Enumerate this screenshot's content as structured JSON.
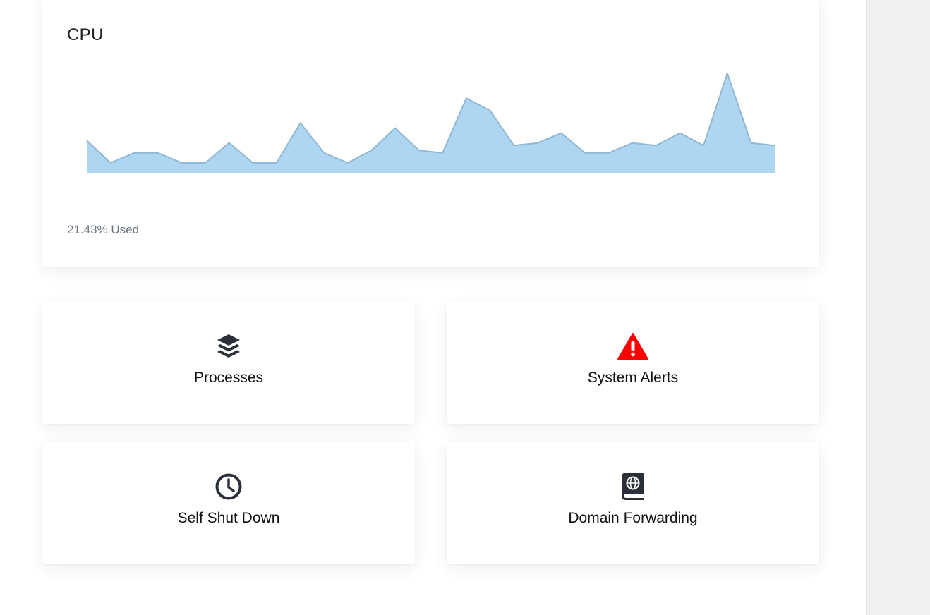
{
  "cpu_card": {
    "title": "CPU",
    "usage_text": "21.43% Used"
  },
  "chart_data": {
    "type": "area",
    "title": "CPU",
    "xlabel": "",
    "ylabel": "",
    "grid": false,
    "fill_color": "#aed6f1",
    "line_color": "#8fb8d6",
    "x": [
      0,
      1,
      2,
      3,
      4,
      5,
      6,
      7,
      8,
      9,
      10,
      11,
      12,
      13,
      14,
      15,
      16,
      17,
      18,
      19,
      20,
      21,
      22,
      23,
      24,
      25,
      26,
      27,
      28,
      29
    ],
    "values": [
      13,
      4,
      8,
      8,
      4,
      4,
      12,
      4,
      4,
      20,
      8,
      4,
      9,
      18,
      9,
      8,
      30,
      25,
      11,
      12,
      16,
      8,
      8,
      12,
      11,
      16,
      11,
      40,
      12,
      11
    ],
    "ylim": [
      0,
      40
    ]
  },
  "tiles": [
    {
      "label": "Processes",
      "icon": "layers-icon",
      "icon_color": "#2b3038"
    },
    {
      "label": "System Alerts",
      "icon": "warning-triangle-icon",
      "icon_color": "#ff0000"
    },
    {
      "label": "Self Shut Down",
      "icon": "clock-icon",
      "icon_color": "#2b3038"
    },
    {
      "label": "Domain Forwarding",
      "icon": "globe-book-icon",
      "icon_color": "#2b3038"
    }
  ]
}
